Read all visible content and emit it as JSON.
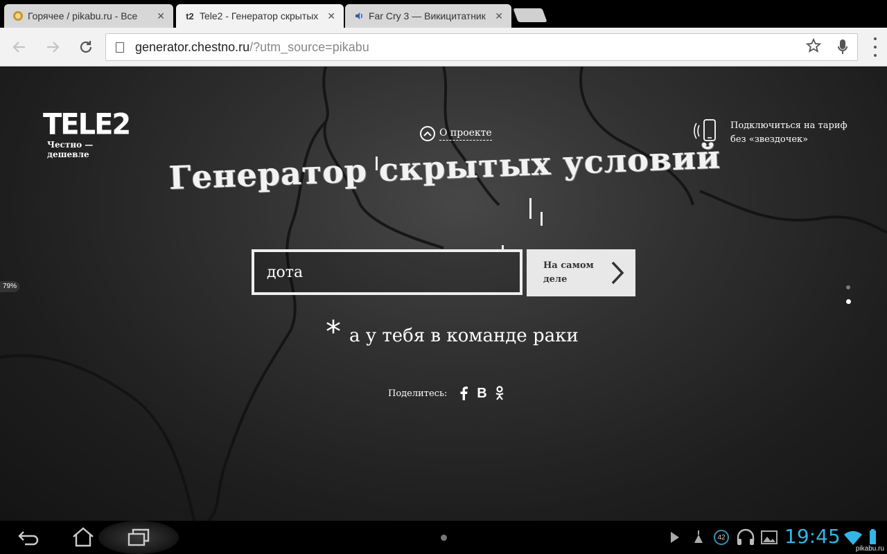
{
  "tabs": [
    {
      "title": "Горячее / pikabu.ru - Все",
      "favicon": "pikabu-icon",
      "active": false
    },
    {
      "title": "Tele2 - Генератор скрытых",
      "favicon": "t2",
      "active": true
    },
    {
      "title": "Far Cry 3 — Викицитатник",
      "favicon": "wiki-speaker-icon",
      "active": false
    }
  ],
  "tab_close_glyph": "✕",
  "toolbar": {
    "url_host": "generator.chestno.ru",
    "url_path": "/?utm_source=pikabu"
  },
  "page": {
    "logo_brand": "TELE2",
    "logo_slogan": "Честно — дешевле",
    "about_label": "О проекте",
    "tariff_line1": "Подключиться на тариф",
    "tariff_line2": "без «звездочек»",
    "headline": "Генератор скрытых условий",
    "search_value": "дота",
    "submit_line1": "На самом",
    "submit_line2": "деле",
    "result_asterisk": "*",
    "result_text": "а у тебя в команде раки",
    "share_label": "Поделитесь:",
    "share_vk": "В",
    "battery_pill": "79%"
  },
  "system_bar": {
    "notification_count": "42",
    "clock": "19:45",
    "accent_color": "#33b5e5"
  },
  "watermark": "pikabu.ru"
}
